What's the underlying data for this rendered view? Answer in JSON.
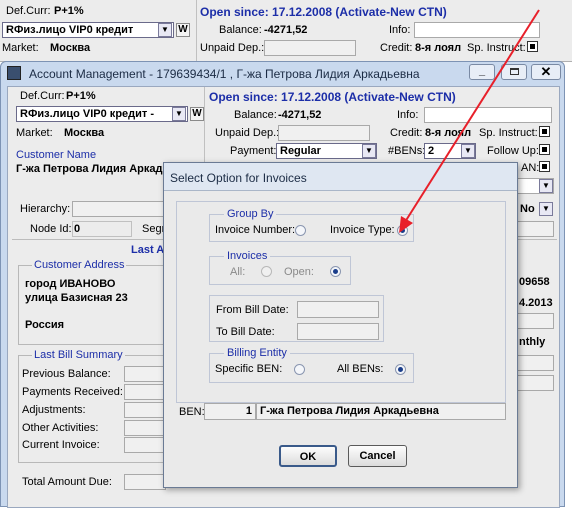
{
  "top": {
    "def_curr_label": "Def.Curr:",
    "def_curr_value": "P+1%",
    "tariff_value": "RФиз.лицо  VIP0  кредит",
    "w_label": "W",
    "market_label": "Market:",
    "market_value": "Москва",
    "open_since": "Open since: 17.12.2008 (Activate-New CTN)",
    "balance_label": "Balance:",
    "balance_value": "-4271,52",
    "info_label": "Info:",
    "unpaid_label": "Unpaid Dep.:",
    "credit_label": "Credit:",
    "credit_value": "8-я лоял",
    "sp_instruct_label": "Sp. Instruct:"
  },
  "window": {
    "title": "Account Management - 179639434/1 , Г-жа Петрова Лидия Аркадьевна",
    "def_curr_label": "Def.Curr:",
    "def_curr_value": "P+1%",
    "tariff_value": "RФиз.лицо  VIP0  кредит -",
    "w_label": "W",
    "market_label": "Market:",
    "market_value": "Москва",
    "customer_name_label": "Customer Name",
    "customer_name_value": "Г-жа Петрова Лидия Аркад",
    "open_since": "Open since: 17.12.2008 (Activate-New CTN)",
    "balance_label": "Balance:",
    "balance_value": "-4271,52",
    "info_label": "Info:",
    "unpaid_label": "Unpaid Dep.:",
    "credit_label": "Credit:",
    "credit_value": "8-я лоял",
    "sp_instruct_label": "Sp. Instruct:",
    "payment_label": "Payment:",
    "payment_value": "Regular",
    "bens_label": "#BENs:",
    "bens_value": "2",
    "follow_up_label": "Follow Up:",
    "ban_partial": "AN:",
    "hierarchy_label": "Hierarchy:",
    "node_id_label": "Node Id:",
    "node_id_value": "0",
    "segm_partial": "Segm",
    "no_value": "No",
    "last_partial": "Last A",
    "customer_address_title": "Customer Address",
    "address_lines": [
      "город ИВАНОВО",
      "улица Базисная  23",
      "Россия"
    ],
    "right_value_1": "09658",
    "right_value_2": "4.2013",
    "right_value_3": "nthly",
    "last_bill_title": "Last Bill Summary",
    "bill_rows": [
      "Previous Balance:",
      "Payments Received:",
      "Adjustments:",
      "Other Activities:",
      "Current Invoice:"
    ],
    "total_label": "Total Amount Due:"
  },
  "dialog": {
    "title": "Select Option for Invoices",
    "group_by_title": "Group By",
    "invoice_number_label": "Invoice Number:",
    "invoice_number_u": "N",
    "invoice_type_label": "Invoice Type:",
    "invoice_type_u": "T",
    "invoices_title": "Invoices",
    "all_label": "All:",
    "open_label": "Open:",
    "from_bill_label": "From Bill Date:",
    "to_bill_label": "To Bill Date:",
    "billing_entity_title": "Billing Entity",
    "specific_ben_label": "Specific BEN:",
    "all_bens_label": "All BENs:",
    "ben_label": "BEN:",
    "ben_number": "1",
    "ben_name": "Г-жа Петрова Лидия Аркадьевна",
    "ok_label": "OK",
    "cancel_label": "Cancel"
  },
  "colors": {
    "title_blue": "#1c2ea8",
    "annotation_arrow": "#e8202a",
    "dialog_bg": "#eaeaea",
    "window_chrome": "#c9d9ee"
  }
}
